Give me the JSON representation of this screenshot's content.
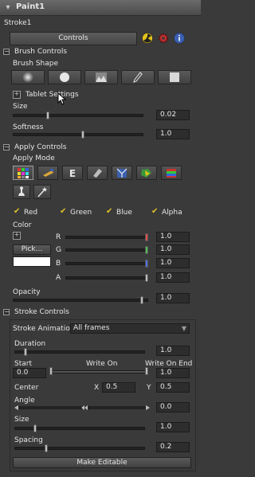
{
  "header": {
    "title": "Paint1"
  },
  "stroke_name": "Stroke1",
  "tabs": [
    {
      "label": "Controls"
    }
  ],
  "brush_controls": {
    "heading": "Brush Controls",
    "brush_shape_label": "Brush Shape",
    "tablet_settings_label": "Tablet Settings",
    "size_label": "Size",
    "size_value": "0.02",
    "size_level": 0.02,
    "softness_label": "Softness",
    "softness_value": "1.0",
    "softness_level": 1.0
  },
  "apply_controls": {
    "heading": "Apply Controls",
    "apply_mode_label": "Apply Mode",
    "channels": [
      {
        "label": "Red",
        "checked": true
      },
      {
        "label": "Green",
        "checked": true
      },
      {
        "label": "Blue",
        "checked": true
      },
      {
        "label": "Alpha",
        "checked": true
      }
    ],
    "color_label": "Color",
    "pick_button": "Pick...",
    "color_swatch": "#ffffff",
    "r_label": "R",
    "r_value": "1.0",
    "g_label": "G",
    "g_value": "1.0",
    "b_label": "B",
    "b_value": "1.0",
    "a_label": "A",
    "a_value": "1.0",
    "opacity_label": "Opacity",
    "opacity_value": "1.0"
  },
  "stroke_controls": {
    "heading": "Stroke Controls",
    "stroke_animation_label": "Stroke Animation",
    "stroke_animation_value": "All frames",
    "duration_label": "Duration",
    "duration_value": "1.0",
    "start_label": "Start",
    "start_value": "0.0",
    "write_on_label": "Write On",
    "write_on_end_label": "Write On End",
    "write_on_end_value": "1.0",
    "center_label": "Center",
    "center_x_label": "X",
    "center_x_value": "0.5",
    "center_y_label": "Y",
    "center_y_value": "0.5",
    "angle_label": "Angle",
    "angle_value": "0.0",
    "size_label": "Size",
    "size_value": "1.0",
    "spacing_label": "Spacing",
    "spacing_value": "0.2",
    "make_editable_button": "Make Editable"
  },
  "colors": {
    "panel_bg": "#3a3a3a",
    "checkmark": "#e3c42a"
  }
}
